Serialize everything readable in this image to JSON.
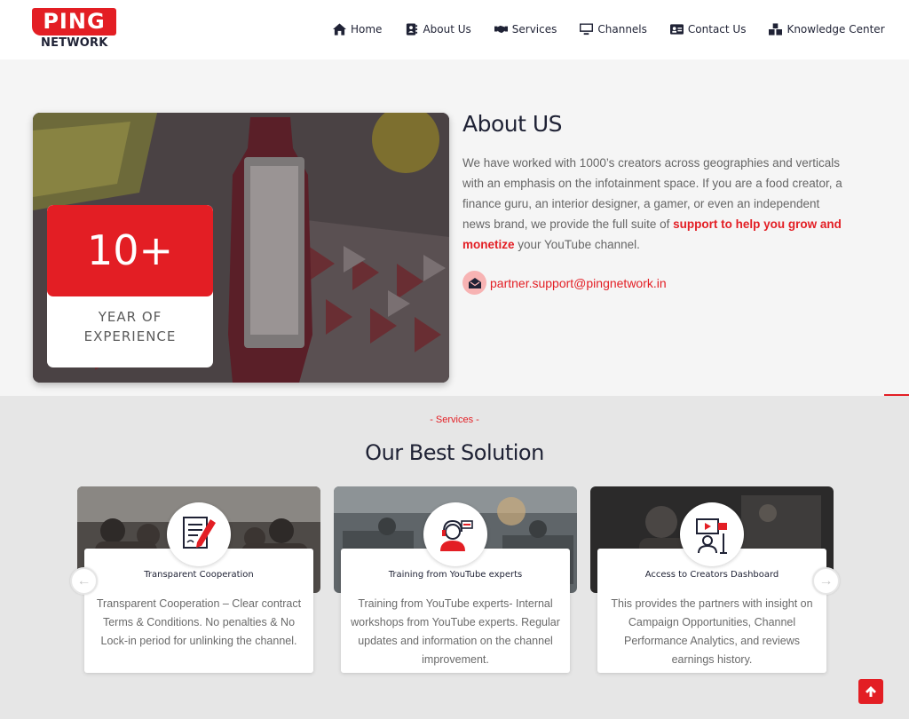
{
  "brand": {
    "logo_top": "PING",
    "logo_bottom": "NETWORK",
    "accent_color": "#e31e24",
    "dark_color": "#1f2235"
  },
  "nav": {
    "items": [
      {
        "label": "Home",
        "icon": "home-icon"
      },
      {
        "label": "About Us",
        "icon": "address-book-icon"
      },
      {
        "label": "Services",
        "icon": "handshake-icon"
      },
      {
        "label": "Channels",
        "icon": "monitor-icon"
      },
      {
        "label": "Contact Us",
        "icon": "id-card-icon"
      },
      {
        "label": "Knowledge Center",
        "icon": "boxes-icon"
      }
    ]
  },
  "about": {
    "experience_value": "10+",
    "experience_label": "YEAR OF EXPERIENCE",
    "title": "About US",
    "text_before": "We have worked with 1000’s creators across geographies and verticals with an emphasis on the infotainment space. If you are a food creator, a finance guru, an interior designer, a gamer, or even an independent news brand, we provide the full suite of ",
    "text_highlight": "support to help you grow and monetize",
    "text_after": " your YouTube channel.",
    "email": "partner.support@pingnetwork.in",
    "email_icon": "envelope-open-icon"
  },
  "services": {
    "kicker": "- Services -",
    "title": "Our Best Solution",
    "cards": [
      {
        "title": "Transparent Cooperation",
        "description": "Transparent Cooperation – Clear contract Terms & Conditions. No penalties & No Lock-in period for unlinking the channel.",
        "icon": "contract-signing-icon"
      },
      {
        "title": "Training from YouTube experts",
        "description": "Training from YouTube experts- Internal workshops from YouTube experts. Regular updates and information on the channel improvement.",
        "icon": "support-agent-icon"
      },
      {
        "title": "Access to Creators Dashboard",
        "description": "This provides the partners with insight on Campaign Opportunities, Channel Performance Analytics, and reviews earnings history.",
        "icon": "creator-studio-icon"
      }
    ],
    "prev_arrow": "←",
    "next_arrow": "→"
  },
  "scroll_top_icon": "arrow-up-icon"
}
